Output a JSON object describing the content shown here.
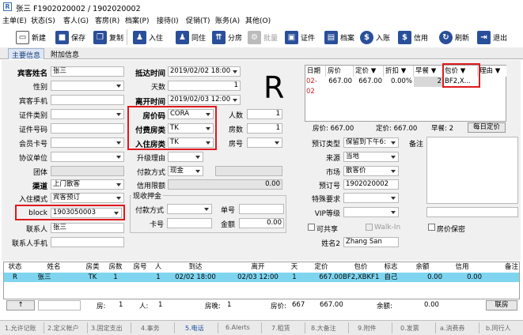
{
  "window": {
    "title": "张三  F1902020002 / 1902020002"
  },
  "menu": [
    "主单(E)",
    "状态(S)",
    "客人(G)",
    "客房(R)",
    "档案(P)",
    "接待(I)",
    "促销(T)",
    "账务(A)",
    "其他(O)"
  ],
  "toolbar": {
    "new": "新建",
    "save": "保存",
    "copy": "复制",
    "checkin": "入住",
    "cohabit": "同住",
    "split": "分房",
    "batch": "批量",
    "cert": "证件",
    "archive": "档案",
    "post": "入账",
    "credit": "信用",
    "refresh": "刷新",
    "exit": "退出"
  },
  "tabs": {
    "main": "主要信息",
    "extra": "附加信息"
  },
  "form": {
    "guest_name_label": "宾客姓名",
    "guest_name": "张三",
    "gender_label": "性别",
    "mobile_label": "宾客手机",
    "idtype_label": "证件类别",
    "idno_label": "证件号码",
    "member_label": "会员卡号",
    "agreement_label": "协议单位",
    "group_label": "团体",
    "channel_label": "渠道",
    "channel": "上门散客",
    "mode_label": "入住模式",
    "mode": "宾客预订",
    "block_label": "block",
    "block": "1903050003",
    "contact_label": "联系人",
    "contact": "张三",
    "contact_mobile_label": "联系人手机",
    "arrive_label": "抵达时间",
    "arrive": "2019/02/02 18:00",
    "days_label": "天数",
    "days": "1",
    "depart_label": "离开时间",
    "depart": "2019/02/03 12:00",
    "ratecode_label": "房价码",
    "ratecode": "CORA",
    "paytype_label": "付费房类",
    "paytype": "TK",
    "roomtype_label": "入住房类",
    "roomtype": "TK",
    "adults_label": "人数",
    "adults": "1",
    "rooms_label": "房数",
    "rooms": "1",
    "roomno_label": "房号",
    "upgrade_label": "升级理由",
    "paymethod_label": "付款方式",
    "paymethod": "现金",
    "creditlimit_label": "信用限额",
    "creditlimit": "0.00",
    "deposit_label": "现收押金",
    "dep_pay_label": "付款方式",
    "dep_card_label": "卡号",
    "dep_no_label": "单号",
    "dep_amount_label": "金额",
    "dep_amount": "0.00",
    "big_letter": "R",
    "resv_type_label": "预订类型",
    "resv_type": "保留到下午6:",
    "source_label": "来源",
    "source": "当地",
    "market_label": "市场",
    "market": "散客价",
    "resvno_label": "预订号",
    "resvno": "1902020002",
    "special_label": "特殊要求",
    "vip_label": "VIP等级",
    "share_label": "可共享",
    "walkin_label": "Walk-In",
    "secret_label": "房价保密",
    "name2_label": "姓名2",
    "name2": "Zhang San",
    "remark_label": "备注"
  },
  "price_grid": {
    "headers": [
      "日期",
      "房价",
      "定价 ▼",
      "折扣 ▼",
      "早餐 ▼",
      "包价 ▼",
      "理由 ▼"
    ],
    "row": {
      "date": "02-02",
      "price": "667.00",
      "list": "667.00",
      "discount": "0.00%",
      "breakfast": "2",
      "package": "BF2,X..."
    },
    "summary": {
      "price": "房价: 667.00",
      "list": "定价: 667.00",
      "breakfast": "早餐: 2",
      "daily": "每日定价"
    }
  },
  "bottom_table": {
    "headers": [
      "状态",
      "姓名",
      "房类",
      "房数",
      "房号",
      "人",
      "到达",
      "离开",
      "天",
      "定价",
      "包价",
      "标志",
      "余额",
      "信用",
      "备注"
    ],
    "row": {
      "status": "R",
      "name": "张三",
      "type": "TK",
      "rooms": "1",
      "people": "1",
      "arrive": "02/02 18:00",
      "depart": "02/03 12:00",
      "days": "1",
      "list": "667.00",
      "package": "BF2,XBKF1",
      "flag": "自己",
      "balance": "0.00",
      "credit": "0.00"
    },
    "footer": {
      "up": "↑",
      "rooms": "房:",
      "rooms_v": "1",
      "people": "人:",
      "people_v": "1",
      "nights": "房晚:",
      "nights_v": "1",
      "price": "房价:",
      "price_v": "667",
      "price_v2": "667.00",
      "balance": "余额:",
      "balance_v": "0.00",
      "link": "联房"
    }
  },
  "statusbar": [
    "1.允许记账",
    "2.定义帐户",
    "3.固定支出",
    "4.事务",
    "5.电话",
    "6.Alerts",
    "7.租赁",
    "8.大备注",
    "9.附件",
    "0.发票",
    "a.消费券",
    "b.同行人"
  ],
  "colors": {
    "highlight_row": "#7fd5f0",
    "red_box": "#e0191f",
    "active_status": "#3a6ab8"
  }
}
